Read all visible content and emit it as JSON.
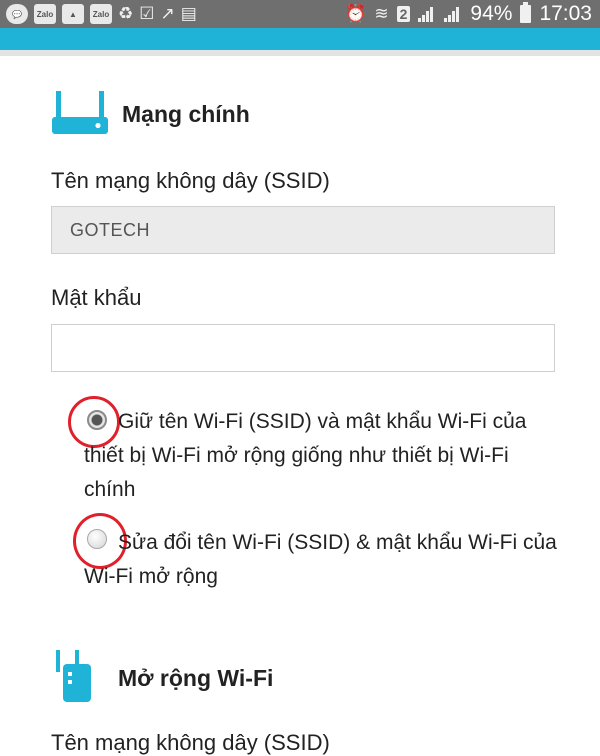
{
  "status_bar": {
    "notifications": [
      "Zalo",
      "Zalo"
    ],
    "sim_badge": "2",
    "battery": "94%",
    "time": "17:03"
  },
  "main_network": {
    "title": "Mạng chính",
    "ssid_label": "Tên mạng không dây (SSID)",
    "ssid_value": "GOTECH",
    "password_label": "Mật khẩu",
    "password_value": "",
    "options": [
      {
        "label": "Giữ tên Wi-Fi (SSID) và mật khẩu Wi-Fi của thiết bị Wi-Fi mở rộng giống như thiết bị Wi-Fi chính",
        "selected": true
      },
      {
        "label": "Sửa đổi tên Wi-Fi (SSID) & mật khẩu Wi-Fi của Wi-Fi mở rộng",
        "selected": false
      }
    ]
  },
  "extender": {
    "title": "Mở rộng Wi-Fi",
    "ssid_label": "Tên mạng không dây (SSID)"
  },
  "colors": {
    "accent": "#1fb3d7",
    "status_bar": "#6f6f6f",
    "highlight_circle": "#e0202a"
  }
}
